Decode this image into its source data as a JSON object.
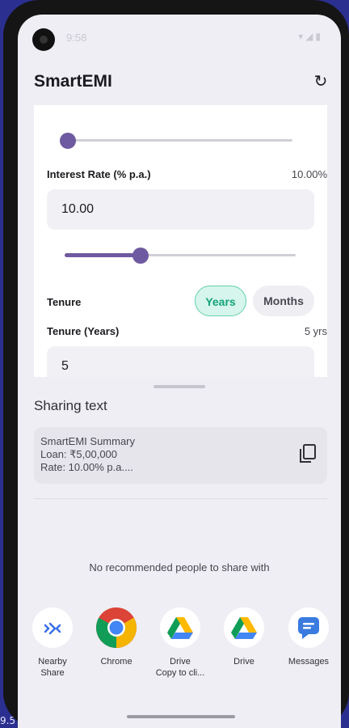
{
  "desktop": {
    "edge_text": "9.5"
  },
  "status_bar": {
    "time": "9:58",
    "icons": "▾◢▮"
  },
  "app_bar": {
    "title": "SmartEMI",
    "refresh_icon": "↻"
  },
  "form": {
    "loan_slider": {
      "fraction": 0.0
    },
    "interest": {
      "label": "Interest Rate (% p.a.)",
      "value_display": "10.00%",
      "input_value": "10.00",
      "slider_fraction": 0.33
    },
    "tenure": {
      "label": "Tenure",
      "options": [
        "Years",
        "Months"
      ],
      "selected": "Years"
    },
    "tenure_years": {
      "label": "Tenure (Years)",
      "value_display": "5 yrs",
      "input_value": "5"
    }
  },
  "share_sheet": {
    "title": "Sharing text",
    "preview_lines": [
      "SmartEMI Summary",
      "Loan: ₹5,00,000",
      "Rate: 10.00% p.a...."
    ],
    "copy_icon": "copy-icon",
    "no_recommend": "No recommended people to share with",
    "apps": [
      {
        "name": "nearby-share",
        "label1": "Nearby",
        "label2": "Share"
      },
      {
        "name": "chrome",
        "label1": "Chrome",
        "label2": ""
      },
      {
        "name": "drive-copy",
        "label1": "Drive",
        "label2": "Copy to cli..."
      },
      {
        "name": "drive",
        "label1": "Drive",
        "label2": ""
      },
      {
        "name": "messages",
        "label1": "Messages",
        "label2": ""
      }
    ]
  },
  "colors": {
    "accent": "#6e5aa0",
    "chip_selected_bg": "#d6f5ec",
    "chip_selected_text": "#13a37a"
  }
}
